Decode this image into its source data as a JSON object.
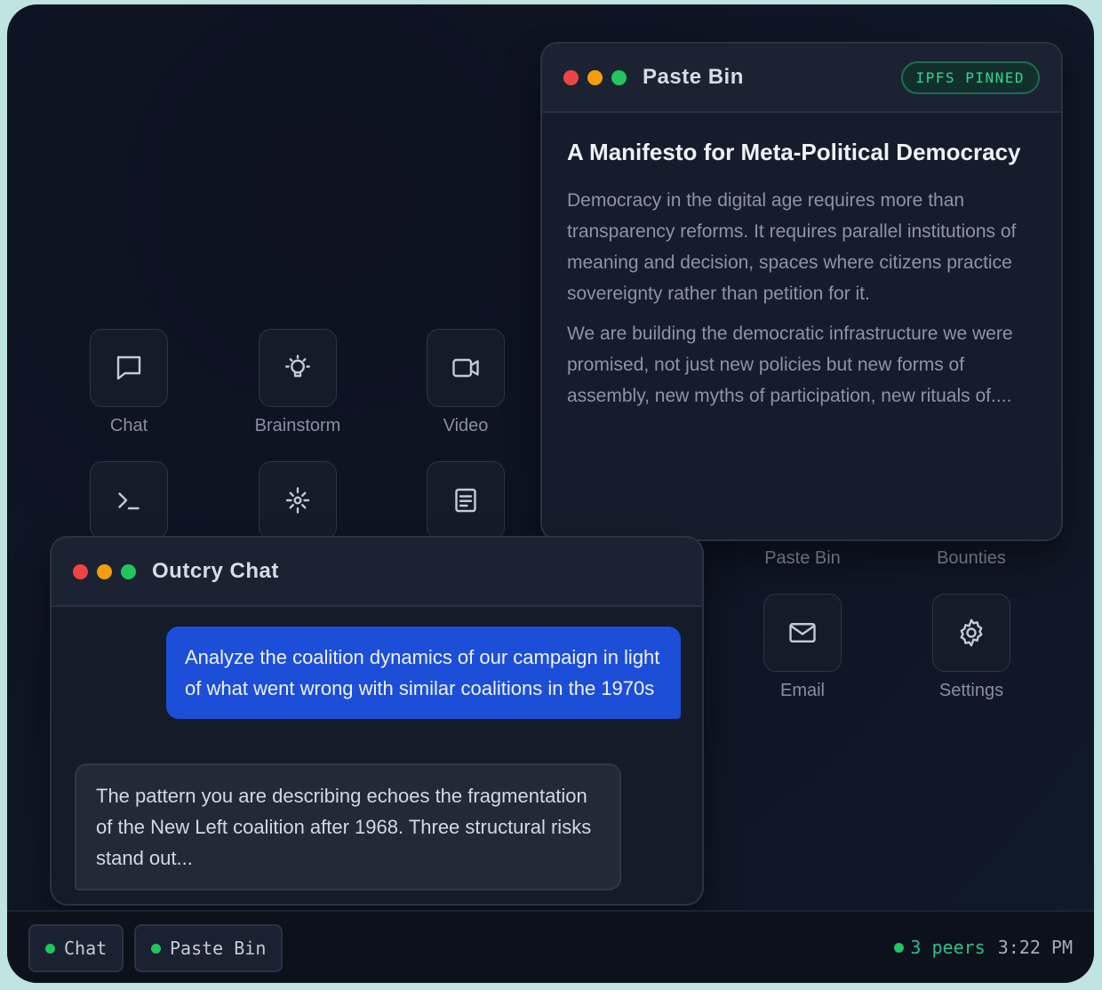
{
  "desktop_icons": {
    "chat": {
      "label": "Chat",
      "icon": "chat-bubble-icon"
    },
    "brainstorm": {
      "label": "Brainstorm",
      "icon": "lightbulb-icon"
    },
    "video": {
      "label": "Video",
      "icon": "video-camera-icon"
    },
    "terminal": {
      "label": "",
      "icon": "terminal-icon"
    },
    "sparkle": {
      "label": "",
      "icon": "sparkle-icon"
    },
    "document": {
      "label": "",
      "icon": "document-icon"
    },
    "paste_bin": {
      "label": "Paste Bin"
    },
    "bounties": {
      "label": "Bounties"
    },
    "email": {
      "label": "Email",
      "icon": "mail-icon"
    },
    "settings": {
      "label": "Settings",
      "icon": "gear-icon"
    }
  },
  "paste_bin_window": {
    "title": "Paste Bin",
    "badge": "IPFS PINNED",
    "doc_title": "A Manifesto for Meta-Political Democracy",
    "paragraphs": [
      "Democracy in the digital age requires more than transparency reforms. It requires parallel institutions of meaning and decision, spaces where citizens practice sovereignty rather than petition for it.",
      "We are building the democratic infrastructure we were promised, not just new policies but new forms of assembly, new myths of participation, new rituals of...."
    ]
  },
  "chat_window": {
    "title": "Outcry Chat",
    "messages": [
      {
        "role": "user",
        "text": "Analyze the coalition dynamics of our campaign in light of what went wrong with similar coalitions in the 1970s"
      },
      {
        "role": "assistant",
        "text": "The pattern you are describing echoes the fragmentation of the New Left coalition after 1968. Three structural risks stand out..."
      }
    ]
  },
  "taskbar": {
    "items": [
      {
        "label": "Chat",
        "status_color": "#22c55e"
      },
      {
        "label": "Paste Bin",
        "status_color": "#22c55e"
      }
    ],
    "peers": "3 peers",
    "time": "3:22 PM"
  },
  "colors": {
    "accent_blue": "#1d4ed8",
    "online_green": "#22c55e",
    "badge_green": "#34d399"
  }
}
